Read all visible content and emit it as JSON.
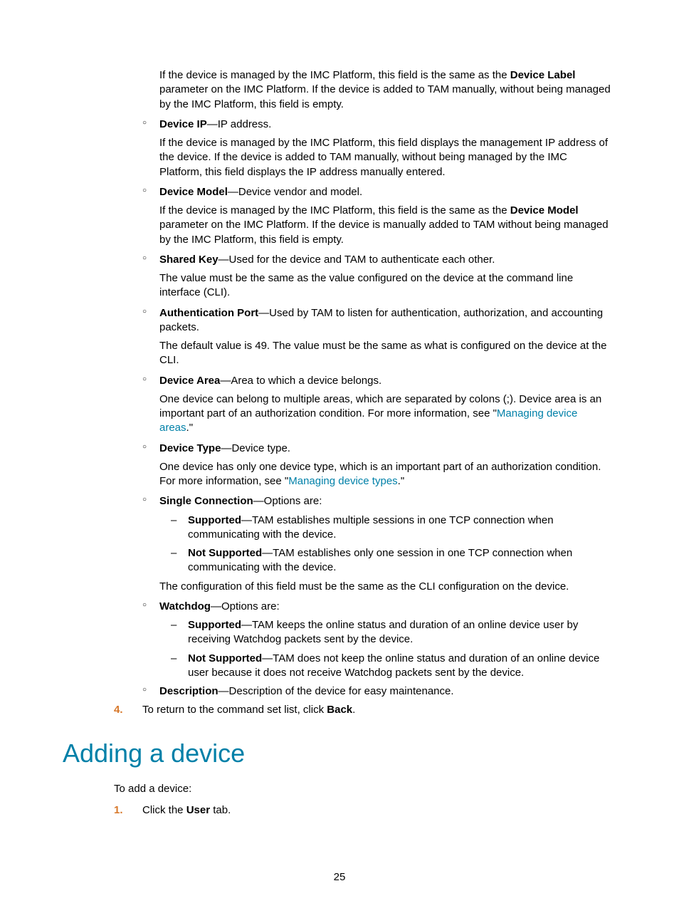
{
  "p1": {
    "pre": "If the device is managed by the IMC Platform, this field is the same as the ",
    "bold": "Device Label",
    "post": " parameter on the IMC Platform. If the device is added to TAM manually, without being managed by the IMC Platform, this field is empty."
  },
  "deviceIP": {
    "label": "Device IP",
    "def": "—IP address.",
    "desc": "If the device is managed by the IMC Platform, this field displays the management IP address of the device. If the device is added to TAM manually, without being managed by the IMC Platform, this field displays the IP address manually entered."
  },
  "deviceModel": {
    "label": "Device Model",
    "def": "—Device vendor and model.",
    "desc_pre": "If the device is managed by the IMC Platform, this field is the same as the ",
    "desc_bold": "Device Model",
    "desc_post": " parameter on the IMC Platform. If the device is manually added to TAM without being managed by the IMC Platform, this field is empty."
  },
  "sharedKey": {
    "label": "Shared Key",
    "def": "—Used for the device and TAM to authenticate each other.",
    "desc": "The value must be the same as the value configured on the device at the command line interface (CLI)."
  },
  "authPort": {
    "label": "Authentication Port",
    "def": "—Used by TAM to listen for authentication, authorization, and accounting packets.",
    "desc": "The default value is 49. The value must be the same as what is configured on the device at the CLI."
  },
  "deviceArea": {
    "label": "Device Area",
    "def": "—Area to which a device belongs.",
    "desc_pre": "One device can belong to multiple areas, which are separated by colons (;). Device area is an important part of an authorization condition. For more information, see \"",
    "link": "Managing device areas",
    "desc_post": ".\""
  },
  "deviceType": {
    "label": "Device Type",
    "def": "—Device type.",
    "desc_pre": "One device has only one device type, which is an important part of an authorization condition. For more information, see \"",
    "link": "Managing device types",
    "desc_post": ".\""
  },
  "singleConn": {
    "label": "Single Connection",
    "def": "—Options are:",
    "supported": {
      "label": "Supported",
      "text": "—TAM establishes multiple sessions in one TCP connection when communicating with the device."
    },
    "notSupported": {
      "label": "Not Supported",
      "text": "—TAM establishes only one session in one TCP connection when communicating with the device."
    },
    "note": "The configuration of this field must be the same as the CLI configuration on the device."
  },
  "watchdog": {
    "label": "Watchdog",
    "def": "—Options are:",
    "supported": {
      "label": "Supported",
      "text": "—TAM keeps the online status and duration of an online device user by receiving Watchdog packets sent by the device."
    },
    "notSupported": {
      "label": "Not Supported",
      "text": "—TAM does not keep the online status and duration of an online device user because it does not receive Watchdog packets sent by the device."
    }
  },
  "description": {
    "label": "Description",
    "def": "—Description of the device for easy maintenance."
  },
  "step4": {
    "num": "4.",
    "pre": "To return to the command set list, click ",
    "bold": "Back",
    "post": "."
  },
  "heading": "Adding a device",
  "intro": "To add a device:",
  "step1": {
    "num": "1.",
    "pre": "Click the ",
    "bold": "User",
    "post": " tab."
  },
  "pageNumber": "25"
}
